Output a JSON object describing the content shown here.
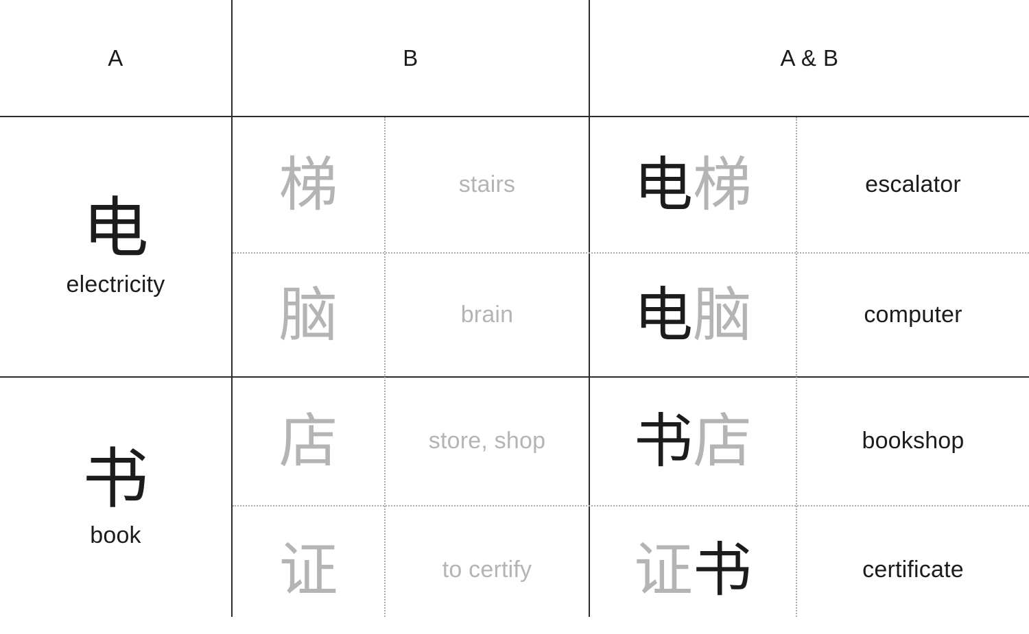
{
  "headers": {
    "col_a": "A",
    "col_b": "B",
    "col_ab": "A & B"
  },
  "groups": [
    {
      "base": {
        "hanzi": "电",
        "gloss": "electricity"
      },
      "rows": [
        {
          "b_hanzi": "梯",
          "b_gloss": "stairs",
          "compound_first": "电",
          "compound_second": "梯",
          "compound_first_tone": "dark",
          "compound_second_tone": "gray",
          "meaning": "escalator"
        },
        {
          "b_hanzi": "脑",
          "b_gloss": "brain",
          "compound_first": "电",
          "compound_second": "脑",
          "compound_first_tone": "dark",
          "compound_second_tone": "gray",
          "meaning": "computer"
        }
      ]
    },
    {
      "base": {
        "hanzi": "书",
        "gloss": "book"
      },
      "rows": [
        {
          "b_hanzi": "店",
          "b_gloss": "store, shop",
          "compound_first": "书",
          "compound_second": "店",
          "compound_first_tone": "dark",
          "compound_second_tone": "gray",
          "meaning": "bookshop"
        },
        {
          "b_hanzi": "证",
          "b_gloss": "to certify",
          "compound_first": "证",
          "compound_second": "书",
          "compound_first_tone": "gray",
          "compound_second_tone": "dark",
          "meaning": "certificate"
        }
      ]
    }
  ],
  "colors": {
    "text_dark": "#1c1c1c",
    "text_gray": "#b4b4b4",
    "rule_solid": "#2b2b2b",
    "rule_dotted": "#a9a9a9",
    "background": "#ffffff"
  }
}
